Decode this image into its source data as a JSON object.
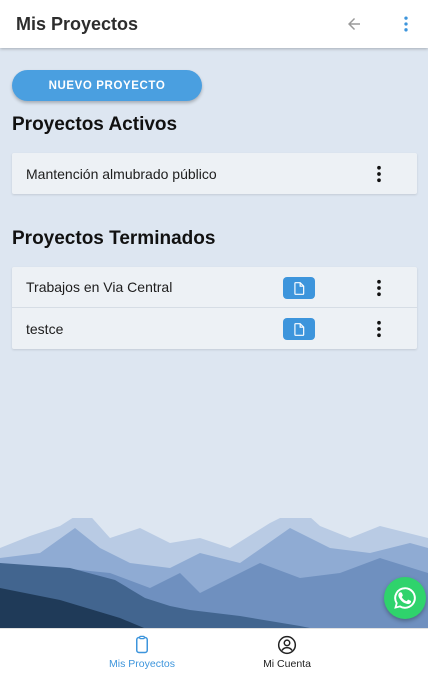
{
  "header": {
    "title": "Mis Proyectos",
    "back_icon": "arrow-left-icon",
    "menu_icon": "more-vert-icon"
  },
  "actions": {
    "new_project_label": "NUEVO PROYECTO"
  },
  "active_projects": {
    "title": "Proyectos Activos",
    "items": [
      {
        "name": "Mantención almubrado público"
      }
    ]
  },
  "finished_projects": {
    "title": "Proyectos Terminados",
    "items": [
      {
        "name": "Trabajos en Via Central"
      },
      {
        "name": "testce"
      }
    ]
  },
  "bottom_nav": {
    "tabs": [
      {
        "label": "Mis Proyectos",
        "icon": "clipboard-icon",
        "active": true
      },
      {
        "label": "Mi Cuenta",
        "icon": "account-circle-icon",
        "active": false
      }
    ]
  },
  "colors": {
    "accent": "#3d95dc",
    "background": "#dde6f1",
    "whatsapp": "#2fd36c"
  }
}
